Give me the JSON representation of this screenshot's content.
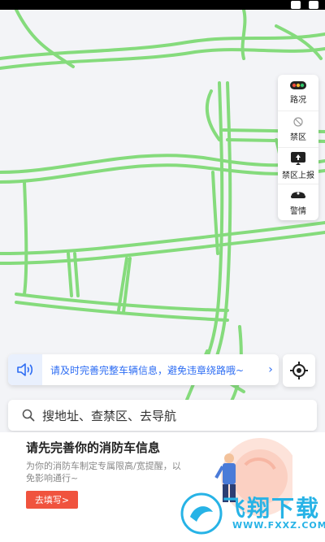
{
  "side_panel": {
    "items": [
      {
        "label": "路况",
        "icon": "traffic-light-icon"
      },
      {
        "label": "禁区",
        "icon": "restricted-zone-icon"
      },
      {
        "label": "禁区上报",
        "icon": "report-zone-icon"
      },
      {
        "label": "警情",
        "icon": "police-icon"
      }
    ]
  },
  "notice": {
    "text": "请及时完善完整车辆信息，避免违章绕路哦~",
    "chevron": "›"
  },
  "search": {
    "placeholder": "搜地址、查禁区、去导航"
  },
  "card": {
    "title": "请先完善你的消防车信息",
    "description": "为你的消防车制定专属限高/宽提醒，以免影响通行~",
    "cta_label": "去填写>"
  },
  "watermark": {
    "text": "飞翔下载",
    "url": "WWW.FXXZ.COM"
  },
  "colors": {
    "road_green": "#6cd36a",
    "accent_blue": "#2c6cf3",
    "cta_red": "#f0533e"
  }
}
